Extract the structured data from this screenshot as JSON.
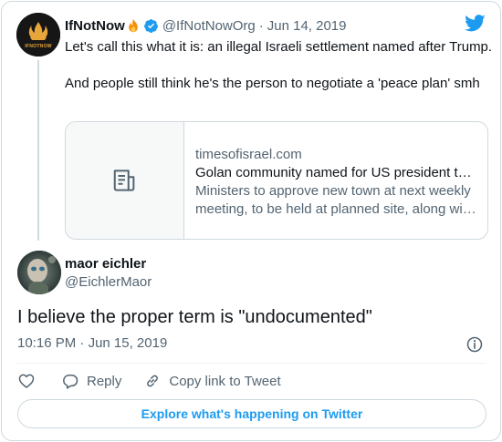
{
  "parent_tweet": {
    "display_name": "IfNotNow",
    "name_emoji": "fire-emoji",
    "verified_icon": "verified-badge-icon",
    "handle": "@IfNotNowOrg",
    "separator": "·",
    "date": "Jun 14, 2019",
    "avatar_text": "IFNOTNOW",
    "text_paragraphs": [
      "Let's call this what it is: an illegal Israeli settlement named after Trump.",
      "And people still think he's the person to negotiate a 'peace plan' smh"
    ],
    "link_card": {
      "thumbnail_icon": "article-icon",
      "domain": "timesofisrael.com",
      "title": "Golan community named for US president to rise on site of previous failed settlement",
      "description": "Ministers to approve new town at next weekly meeting, to be held at planned site, along with ceremony for new road"
    }
  },
  "reply_tweet": {
    "display_name": "maor eichler",
    "handle": "@EichlerMaor",
    "text": "I believe the proper term is \"undocumented\"",
    "time": "10:16 PM",
    "separator": "·",
    "date": "Jun 15, 2019"
  },
  "actions": {
    "like_icon": "heart-icon",
    "reply_icon": "reply-icon",
    "reply_label": "Reply",
    "copy_icon": "link-icon",
    "copy_label": "Copy link to Tweet"
  },
  "explore_button_label": "Explore what's happening on Twitter",
  "colors": {
    "brand_blue": "#1d9bf0",
    "text_primary": "#0f1419",
    "text_secondary": "#536471",
    "border": "#cfd9de"
  }
}
